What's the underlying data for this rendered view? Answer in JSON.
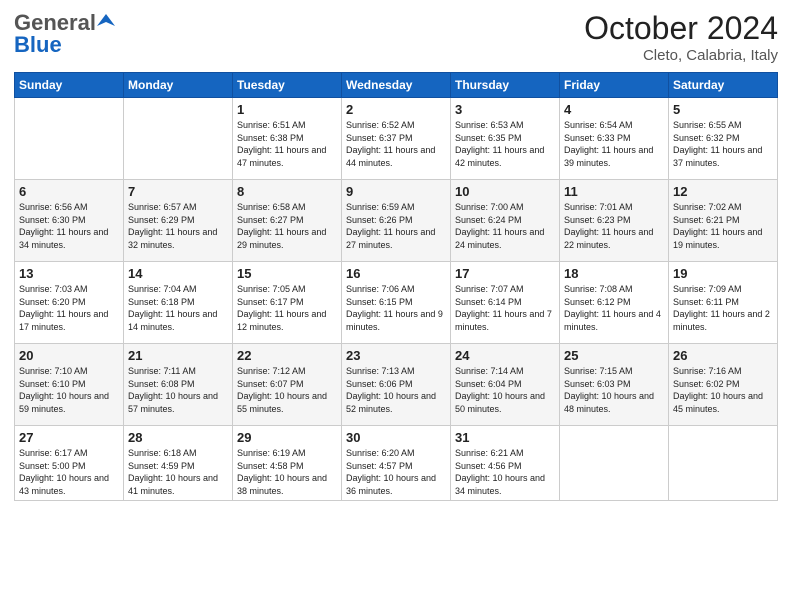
{
  "header": {
    "logo_general": "General",
    "logo_blue": "Blue",
    "month": "October 2024",
    "location": "Cleto, Calabria, Italy"
  },
  "days_of_week": [
    "Sunday",
    "Monday",
    "Tuesday",
    "Wednesday",
    "Thursday",
    "Friday",
    "Saturday"
  ],
  "weeks": [
    [
      {
        "day": "",
        "info": ""
      },
      {
        "day": "",
        "info": ""
      },
      {
        "day": "1",
        "info": "Sunrise: 6:51 AM\nSunset: 6:38 PM\nDaylight: 11 hours and 47 minutes."
      },
      {
        "day": "2",
        "info": "Sunrise: 6:52 AM\nSunset: 6:37 PM\nDaylight: 11 hours and 44 minutes."
      },
      {
        "day": "3",
        "info": "Sunrise: 6:53 AM\nSunset: 6:35 PM\nDaylight: 11 hours and 42 minutes."
      },
      {
        "day": "4",
        "info": "Sunrise: 6:54 AM\nSunset: 6:33 PM\nDaylight: 11 hours and 39 minutes."
      },
      {
        "day": "5",
        "info": "Sunrise: 6:55 AM\nSunset: 6:32 PM\nDaylight: 11 hours and 37 minutes."
      }
    ],
    [
      {
        "day": "6",
        "info": "Sunrise: 6:56 AM\nSunset: 6:30 PM\nDaylight: 11 hours and 34 minutes."
      },
      {
        "day": "7",
        "info": "Sunrise: 6:57 AM\nSunset: 6:29 PM\nDaylight: 11 hours and 32 minutes."
      },
      {
        "day": "8",
        "info": "Sunrise: 6:58 AM\nSunset: 6:27 PM\nDaylight: 11 hours and 29 minutes."
      },
      {
        "day": "9",
        "info": "Sunrise: 6:59 AM\nSunset: 6:26 PM\nDaylight: 11 hours and 27 minutes."
      },
      {
        "day": "10",
        "info": "Sunrise: 7:00 AM\nSunset: 6:24 PM\nDaylight: 11 hours and 24 minutes."
      },
      {
        "day": "11",
        "info": "Sunrise: 7:01 AM\nSunset: 6:23 PM\nDaylight: 11 hours and 22 minutes."
      },
      {
        "day": "12",
        "info": "Sunrise: 7:02 AM\nSunset: 6:21 PM\nDaylight: 11 hours and 19 minutes."
      }
    ],
    [
      {
        "day": "13",
        "info": "Sunrise: 7:03 AM\nSunset: 6:20 PM\nDaylight: 11 hours and 17 minutes."
      },
      {
        "day": "14",
        "info": "Sunrise: 7:04 AM\nSunset: 6:18 PM\nDaylight: 11 hours and 14 minutes."
      },
      {
        "day": "15",
        "info": "Sunrise: 7:05 AM\nSunset: 6:17 PM\nDaylight: 11 hours and 12 minutes."
      },
      {
        "day": "16",
        "info": "Sunrise: 7:06 AM\nSunset: 6:15 PM\nDaylight: 11 hours and 9 minutes."
      },
      {
        "day": "17",
        "info": "Sunrise: 7:07 AM\nSunset: 6:14 PM\nDaylight: 11 hours and 7 minutes."
      },
      {
        "day": "18",
        "info": "Sunrise: 7:08 AM\nSunset: 6:12 PM\nDaylight: 11 hours and 4 minutes."
      },
      {
        "day": "19",
        "info": "Sunrise: 7:09 AM\nSunset: 6:11 PM\nDaylight: 11 hours and 2 minutes."
      }
    ],
    [
      {
        "day": "20",
        "info": "Sunrise: 7:10 AM\nSunset: 6:10 PM\nDaylight: 10 hours and 59 minutes."
      },
      {
        "day": "21",
        "info": "Sunrise: 7:11 AM\nSunset: 6:08 PM\nDaylight: 10 hours and 57 minutes."
      },
      {
        "day": "22",
        "info": "Sunrise: 7:12 AM\nSunset: 6:07 PM\nDaylight: 10 hours and 55 minutes."
      },
      {
        "day": "23",
        "info": "Sunrise: 7:13 AM\nSunset: 6:06 PM\nDaylight: 10 hours and 52 minutes."
      },
      {
        "day": "24",
        "info": "Sunrise: 7:14 AM\nSunset: 6:04 PM\nDaylight: 10 hours and 50 minutes."
      },
      {
        "day": "25",
        "info": "Sunrise: 7:15 AM\nSunset: 6:03 PM\nDaylight: 10 hours and 48 minutes."
      },
      {
        "day": "26",
        "info": "Sunrise: 7:16 AM\nSunset: 6:02 PM\nDaylight: 10 hours and 45 minutes."
      }
    ],
    [
      {
        "day": "27",
        "info": "Sunrise: 6:17 AM\nSunset: 5:00 PM\nDaylight: 10 hours and 43 minutes."
      },
      {
        "day": "28",
        "info": "Sunrise: 6:18 AM\nSunset: 4:59 PM\nDaylight: 10 hours and 41 minutes."
      },
      {
        "day": "29",
        "info": "Sunrise: 6:19 AM\nSunset: 4:58 PM\nDaylight: 10 hours and 38 minutes."
      },
      {
        "day": "30",
        "info": "Sunrise: 6:20 AM\nSunset: 4:57 PM\nDaylight: 10 hours and 36 minutes."
      },
      {
        "day": "31",
        "info": "Sunrise: 6:21 AM\nSunset: 4:56 PM\nDaylight: 10 hours and 34 minutes."
      },
      {
        "day": "",
        "info": ""
      },
      {
        "day": "",
        "info": ""
      }
    ]
  ]
}
